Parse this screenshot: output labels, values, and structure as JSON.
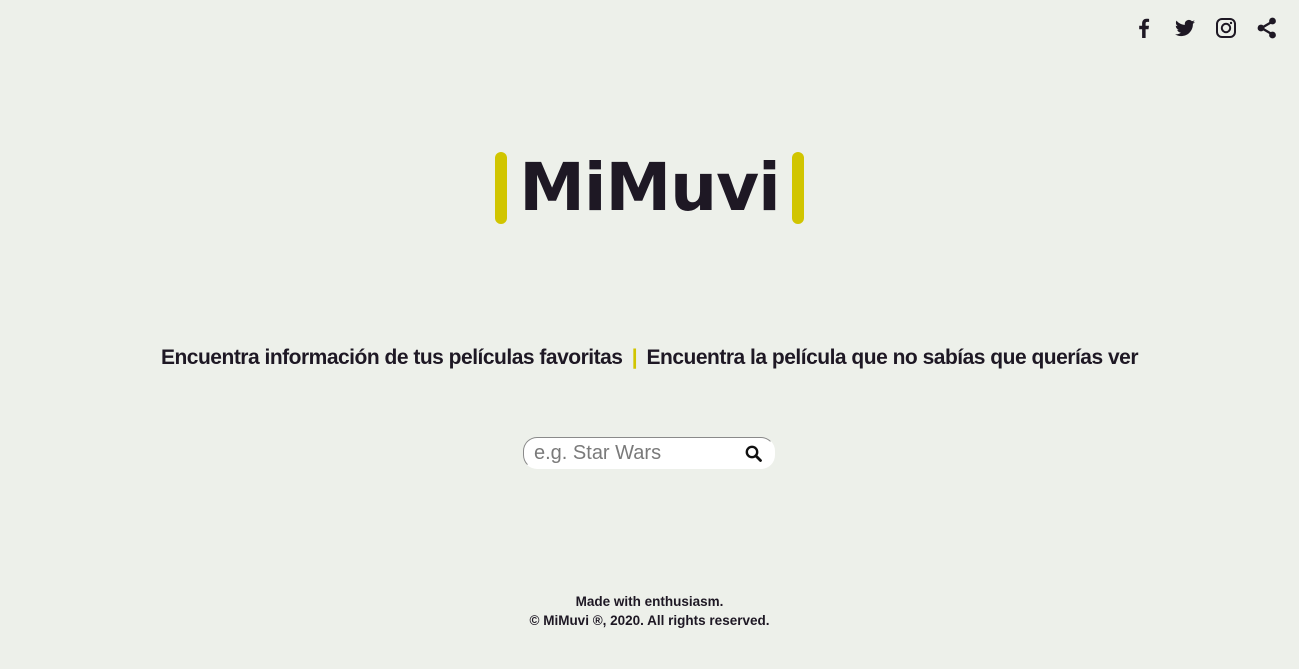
{
  "social": {
    "icons": [
      "facebook-icon",
      "twitter-icon",
      "instagram-icon",
      "share-icon"
    ]
  },
  "logo": {
    "text": "MiMuvi",
    "accent_color": "#d1c500",
    "text_color": "#1e1824"
  },
  "tagline": {
    "left": "Encuentra información de tus películas favoritas",
    "separator": "|",
    "right": "Encuentra la película que no sabías que querías ver"
  },
  "search": {
    "placeholder": "e.g. Star Wars",
    "value": "",
    "icon": "search-icon"
  },
  "footer": {
    "line1": "Made with enthusiasm.",
    "line2": "© MiMuvi ®, 2020. All rights reserved."
  },
  "colors": {
    "background": "#edf0ea",
    "accent": "#d1c500",
    "text": "#1e1824"
  }
}
